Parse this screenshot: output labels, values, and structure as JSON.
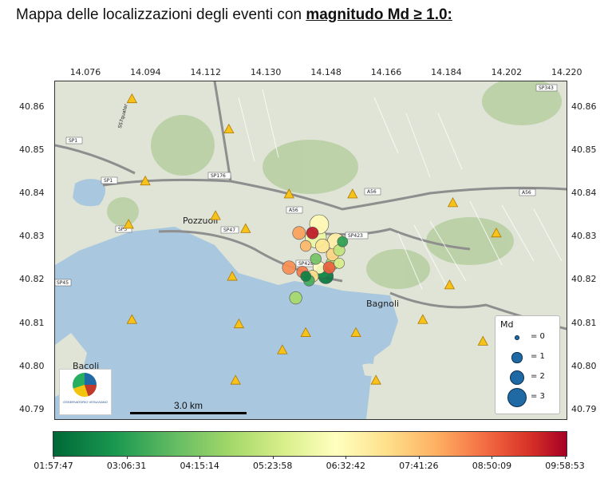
{
  "title": {
    "prefix": "Mappa delle localizzazioni degli eventi con ",
    "bold": "magnitudo Md ≥ 1.0:"
  },
  "axes": {
    "x_ticks": [
      "14.076",
      "14.094",
      "14.112",
      "14.130",
      "14.148",
      "14.166",
      "14.184",
      "14.202",
      "14.220"
    ],
    "y_ticks": [
      "40.86",
      "40.85",
      "40.84",
      "40.83",
      "40.82",
      "40.81",
      "40.80",
      "40.79"
    ],
    "lon_range": [
      14.067,
      14.22
    ],
    "lat_range": [
      40.788,
      40.866
    ]
  },
  "map_labels": {
    "places": [
      "Pozzuoli",
      "Bagnoli",
      "Bacoli"
    ],
    "roads": [
      "SP1",
      "SP1",
      "SP176",
      "A56",
      "A56",
      "A56",
      "SP47",
      "SP423",
      "SP428",
      "SP45",
      "SP3",
      "SS7quater",
      "SP343"
    ]
  },
  "stations": [
    {
      "lon": 14.09,
      "lat": 40.862
    },
    {
      "lon": 14.119,
      "lat": 40.855
    },
    {
      "lon": 14.094,
      "lat": 40.843
    },
    {
      "lon": 14.115,
      "lat": 40.835
    },
    {
      "lon": 14.124,
      "lat": 40.832
    },
    {
      "lon": 14.089,
      "lat": 40.833
    },
    {
      "lon": 14.137,
      "lat": 40.84
    },
    {
      "lon": 14.156,
      "lat": 40.84
    },
    {
      "lon": 14.186,
      "lat": 40.838
    },
    {
      "lon": 14.199,
      "lat": 40.831
    },
    {
      "lon": 14.12,
      "lat": 40.821
    },
    {
      "lon": 14.185,
      "lat": 40.819
    },
    {
      "lon": 14.09,
      "lat": 40.811
    },
    {
      "lon": 14.122,
      "lat": 40.81
    },
    {
      "lon": 14.142,
      "lat": 40.808
    },
    {
      "lon": 14.157,
      "lat": 40.808
    },
    {
      "lon": 14.177,
      "lat": 40.811
    },
    {
      "lon": 14.195,
      "lat": 40.806
    },
    {
      "lon": 14.135,
      "lat": 40.804
    },
    {
      "lon": 14.121,
      "lat": 40.797
    },
    {
      "lon": 14.163,
      "lat": 40.797
    }
  ],
  "events": [
    {
      "lon": 14.145,
      "lat": 40.83,
      "md": 3.2,
      "t": 0.45
    },
    {
      "lon": 14.146,
      "lat": 40.833,
      "md": 2.8,
      "t": 0.52
    },
    {
      "lon": 14.151,
      "lat": 40.829,
      "md": 2.4,
      "t": 0.55
    },
    {
      "lon": 14.144,
      "lat": 40.831,
      "md": 1.4,
      "t": 0.95
    },
    {
      "lon": 14.14,
      "lat": 40.831,
      "md": 1.6,
      "t": 0.72
    },
    {
      "lon": 14.142,
      "lat": 40.828,
      "md": 1.2,
      "t": 0.68
    },
    {
      "lon": 14.147,
      "lat": 40.828,
      "md": 1.8,
      "t": 0.58
    },
    {
      "lon": 14.15,
      "lat": 40.826,
      "md": 1.5,
      "t": 0.62
    },
    {
      "lon": 14.152,
      "lat": 40.827,
      "md": 1.3,
      "t": 0.35
    },
    {
      "lon": 14.153,
      "lat": 40.829,
      "md": 1.1,
      "t": 0.12
    },
    {
      "lon": 14.145,
      "lat": 40.825,
      "md": 1.2,
      "t": 0.22
    },
    {
      "lon": 14.137,
      "lat": 40.823,
      "md": 1.7,
      "t": 0.75
    },
    {
      "lon": 14.141,
      "lat": 40.822,
      "md": 1.3,
      "t": 0.78
    },
    {
      "lon": 14.144,
      "lat": 40.821,
      "md": 1.4,
      "t": 0.6
    },
    {
      "lon": 14.146,
      "lat": 40.823,
      "md": 1.5,
      "t": 0.5
    },
    {
      "lon": 14.148,
      "lat": 40.821,
      "md": 2.0,
      "t": 0.03
    },
    {
      "lon": 14.147,
      "lat": 40.822,
      "md": 1.6,
      "t": 0.08
    },
    {
      "lon": 14.143,
      "lat": 40.82,
      "md": 1.2,
      "t": 0.15
    },
    {
      "lon": 14.15,
      "lat": 40.824,
      "md": 1.6,
      "t": 0.3
    },
    {
      "lon": 14.149,
      "lat": 40.823,
      "md": 1.4,
      "t": 0.82
    },
    {
      "lon": 14.152,
      "lat": 40.824,
      "md": 1.1,
      "t": 0.4
    },
    {
      "lon": 14.142,
      "lat": 40.821,
      "md": 1.1,
      "t": 0.05
    },
    {
      "lon": 14.139,
      "lat": 40.816,
      "md": 1.5,
      "t": 0.3
    }
  ],
  "legend": {
    "title": "Md",
    "items": [
      {
        "md": 0,
        "label": "= 0"
      },
      {
        "md": 1,
        "label": "= 1"
      },
      {
        "md": 2,
        "label": "= 2"
      },
      {
        "md": 3,
        "label": "= 3"
      }
    ]
  },
  "scale_label": "3.0 km",
  "logo_text": "OSSERVATORIO VESUVIANO",
  "colorbar": {
    "ticks": [
      "01:57:47",
      "03:06:31",
      "04:15:14",
      "05:23:58",
      "06:32:42",
      "07:41:26",
      "08:50:09",
      "09:58:53"
    ],
    "colors": [
      "#006837",
      "#1a9850",
      "#66bd63",
      "#a6d96a",
      "#d9ef8b",
      "#ffffbf",
      "#fee08b",
      "#fdae61",
      "#f46d43",
      "#d73027",
      "#a50026"
    ]
  },
  "colors": {
    "sea": "#a9c7de",
    "land": "#dfe4d6",
    "roads": "#ffffff",
    "station": "#f7c21a",
    "station_edge": "#b07a00"
  }
}
